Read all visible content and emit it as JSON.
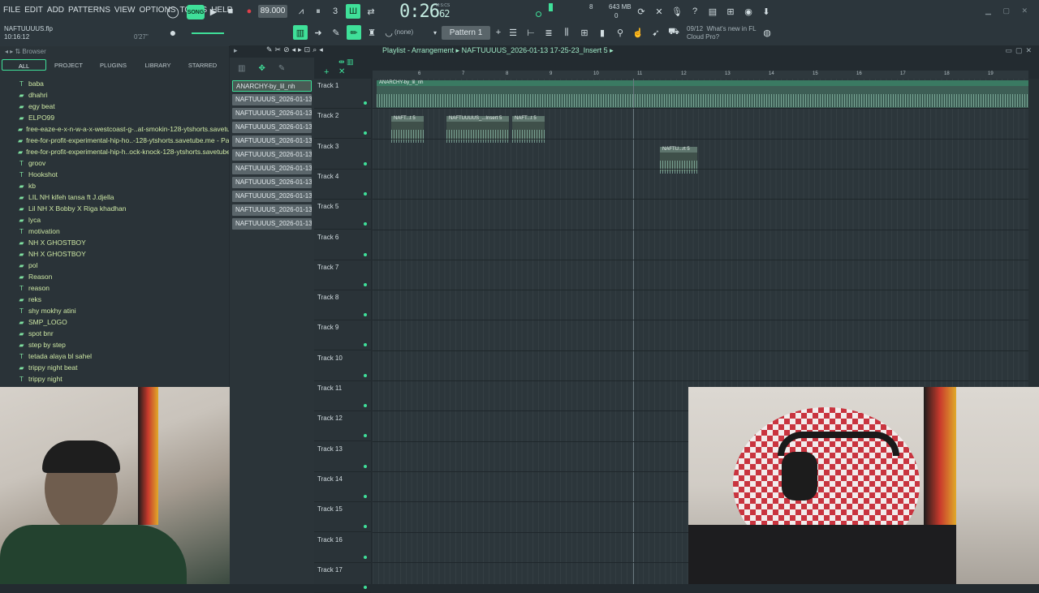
{
  "menu": [
    "FILE",
    "EDIT",
    "ADD",
    "PATTERNS",
    "VIEW",
    "OPTIONS",
    "TOOLS",
    "HELP"
  ],
  "project": {
    "file": "NAFTUUUUS.flp",
    "clock": "10:16:12",
    "elapsed": "0'27\""
  },
  "transport": {
    "song_label": "SONG",
    "tempo": "89.000",
    "time_main": "0:26",
    "time_ms": "62",
    "time_unit": "M:S:CS"
  },
  "monitor": {
    "cpu": "8",
    "memory": "643 MB",
    "poly": "0"
  },
  "pattern": {
    "none_label": "(none)",
    "selected": "Pattern 1"
  },
  "news": {
    "date": "09/12",
    "line1": "What's new in FL",
    "line2": "Cloud Pro?"
  },
  "browser": {
    "title": "Browser",
    "tabs": [
      "ALL",
      "PROJECT",
      "PLUGINS",
      "LIBRARY",
      "STARRED"
    ],
    "items": [
      {
        "icon": "text",
        "label": "baba"
      },
      {
        "icon": "folder",
        "label": "dhahri"
      },
      {
        "icon": "folder",
        "label": "egy beat"
      },
      {
        "icon": "folder",
        "label": "ELPO99"
      },
      {
        "icon": "folder",
        "label": "free-eaze-e-x-n-w-a-x-westcoast-g-..at-smokin-128-ytshorts.savetube.me"
      },
      {
        "icon": "folder",
        "label": "free-for-profit-experimental-hip-ho..-128-ytshorts.savetube.me - Part_2"
      },
      {
        "icon": "folder",
        "label": "free-for-profit-experimental-hip-h..ock-knock-128-ytshorts.savetube.me"
      },
      {
        "icon": "text",
        "label": "groov"
      },
      {
        "icon": "text",
        "label": "Hookshot"
      },
      {
        "icon": "folder",
        "label": "kb"
      },
      {
        "icon": "folder",
        "label": "LIL NH kifeh tansa ft J.djella"
      },
      {
        "icon": "folder",
        "label": "Lil NH X Bobby X Riga khadhan"
      },
      {
        "icon": "folder",
        "label": "lyca"
      },
      {
        "icon": "text",
        "label": "motivation"
      },
      {
        "icon": "folder",
        "label": "NH X GHOSTBOY"
      },
      {
        "icon": "folder",
        "label": "NH X GHOSTBOY"
      },
      {
        "icon": "folder",
        "label": "pol"
      },
      {
        "icon": "folder",
        "label": "Reason"
      },
      {
        "icon": "text",
        "label": "reason"
      },
      {
        "icon": "folder",
        "label": "reks"
      },
      {
        "icon": "text",
        "label": "shy mokhy atini"
      },
      {
        "icon": "folder",
        "label": "SMP_LOGO"
      },
      {
        "icon": "folder",
        "label": "spot bnr"
      },
      {
        "icon": "folder",
        "label": "step by step"
      },
      {
        "icon": "text",
        "label": "tetada alaya bl sahel"
      },
      {
        "icon": "folder",
        "label": "trippy night beat"
      },
      {
        "icon": "text",
        "label": "trippy night"
      }
    ]
  },
  "picker": {
    "items": [
      "ANARCHY-by_lil_nh",
      "NAFTUUUUS_2026-01-13...",
      "NAFTUUUUS_2026-01-13...",
      "NAFTUUUUS_2026-01-13...",
      "NAFTUUUUS_2026-01-13...",
      "NAFTUUUUS_2026-01-13...",
      "NAFTUUUUS_2026-01-13...",
      "NAFTUUUUS_2026-01-13...",
      "NAFTUUUUS_2026-01-13...",
      "NAFTUUUUS_2026-01-13...",
      "NAFTUUUUS_2026-01-13..."
    ]
  },
  "playlist": {
    "title": "Playlist - Arrangement",
    "subtitle": "NAFTUUUUS_2026-01-13 17-25-23_Insert 5",
    "bars": [
      "6",
      "7",
      "8",
      "9",
      "10",
      "11",
      "12",
      "13",
      "14",
      "15",
      "16",
      "17",
      "18",
      "19"
    ],
    "tracks": [
      "Track 1",
      "Track 2",
      "Track 3",
      "Track 4",
      "Track 5",
      "Track 6",
      "Track 7",
      "Track 8",
      "Track 9",
      "Track 10",
      "Track 11",
      "Track 12",
      "Track 13",
      "Track 14",
      "Track 15",
      "Track 16",
      "Track 17"
    ],
    "clips": {
      "t1": "ANARCHY-by_lil_nh",
      "t2a": "NAFT...t 5",
      "t2b": "NAFTUUUUS_...Insert 5",
      "t2c": "NAFT...t 5",
      "t3": "NAFTU...rt 5"
    }
  },
  "colors": {
    "accent": "#3fe099",
    "background": "#232b30"
  }
}
